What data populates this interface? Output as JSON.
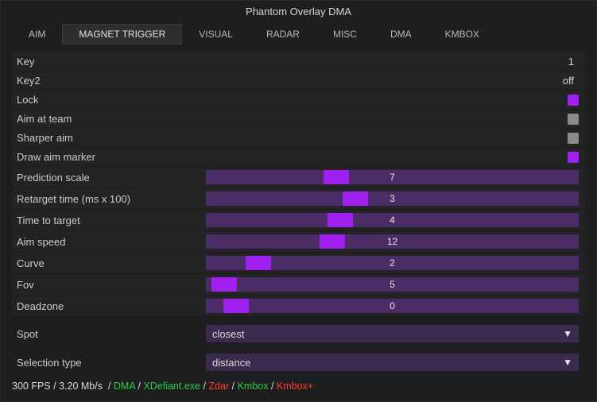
{
  "title": "Phantom Overlay DMA",
  "tabs": [
    {
      "id": "aim",
      "label": "AIM",
      "active": false
    },
    {
      "id": "magnet",
      "label": "MAGNET TRIGGER",
      "active": true
    },
    {
      "id": "visual",
      "label": "VISUAL",
      "active": false
    },
    {
      "id": "radar",
      "label": "RADAR",
      "active": false
    },
    {
      "id": "misc",
      "label": "MISC",
      "active": false
    },
    {
      "id": "dma",
      "label": "DMA",
      "active": false
    },
    {
      "id": "kmbox",
      "label": "KMBOX",
      "active": false
    }
  ],
  "rows": {
    "key": {
      "label": "Key",
      "value": "1"
    },
    "key2": {
      "label": "Key2",
      "value": "off"
    },
    "lock": {
      "label": "Lock",
      "on": true
    },
    "aimteam": {
      "label": "Aim at team",
      "on": false
    },
    "sharper": {
      "label": "Sharper aim",
      "on": false
    },
    "marker": {
      "label": "Draw aim marker",
      "on": true
    },
    "predscale": {
      "label": "Prediction scale",
      "value": "7",
      "min": 0,
      "max": 20,
      "pos": 35
    },
    "retarget": {
      "label": "Retarget time (ms x 100)",
      "value": "3",
      "min": 0,
      "max": 8,
      "pos": 40
    },
    "ttt": {
      "label": "Time to target",
      "value": "4",
      "min": 0,
      "max": 12,
      "pos": 36
    },
    "speed": {
      "label": "Aim speed",
      "value": "12",
      "min": 0,
      "max": 36,
      "pos": 34
    },
    "curve": {
      "label": "Curve",
      "value": "2",
      "min": 0,
      "max": 16,
      "pos": 14
    },
    "fov": {
      "label": "Fov",
      "value": "5",
      "min": 0,
      "max": 100,
      "pos": 5
    },
    "deadzone": {
      "label": "Deadzone",
      "value": "0",
      "min": 0,
      "max": 10,
      "pos": 8
    },
    "spot": {
      "label": "Spot",
      "value": "closest"
    },
    "seltype": {
      "label": "Selection type",
      "value": "distance"
    }
  },
  "footer": {
    "fps": "300 FPS",
    "bw": "3.20 Mb/s",
    "dma": "DMA",
    "exe": "XDefiant.exe",
    "zdar": "Zdar",
    "kmbox": "Kmbox",
    "kmboxp": "Kmbox+"
  }
}
